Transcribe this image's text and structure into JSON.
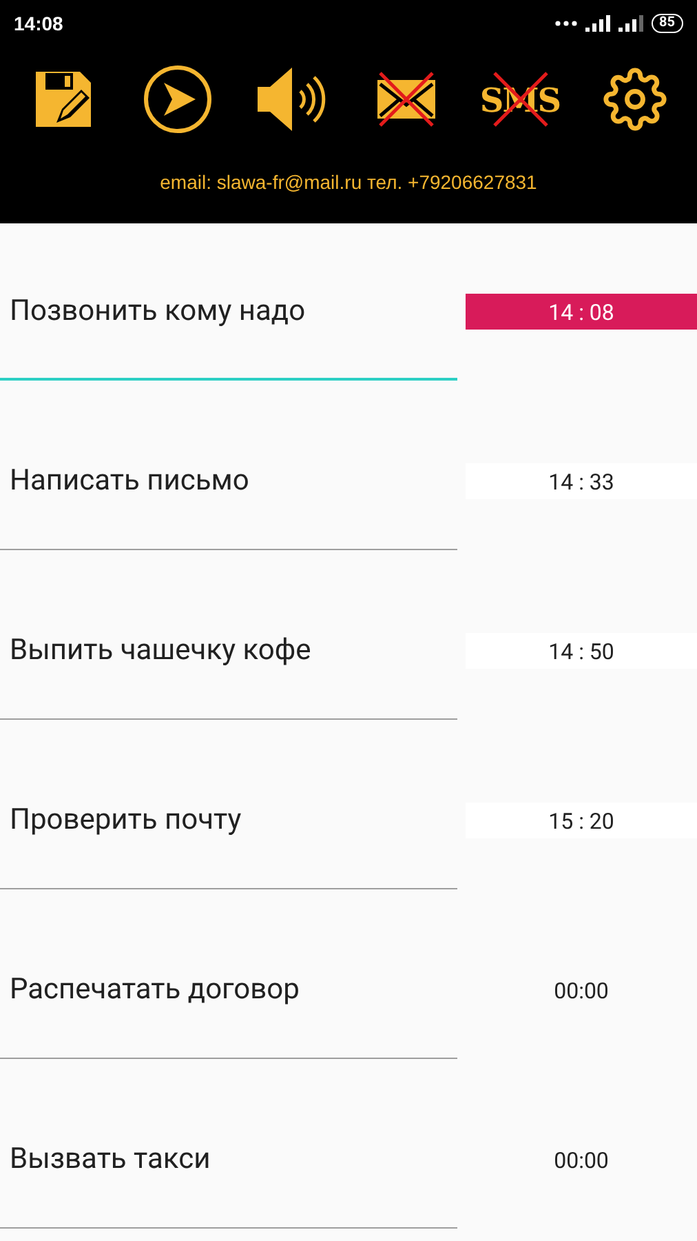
{
  "status_bar": {
    "time": "14:08",
    "battery": "85"
  },
  "toolbar": [
    {
      "kind": "save",
      "crossed": false
    },
    {
      "kind": "play",
      "crossed": false
    },
    {
      "kind": "sound",
      "crossed": false
    },
    {
      "kind": "mail",
      "crossed": true
    },
    {
      "kind": "sms",
      "label": "SMS",
      "crossed": true
    },
    {
      "kind": "settings",
      "crossed": false
    }
  ],
  "contact": "email: slawa-fr@mail.ru тел. +79206627831",
  "tasks": [
    {
      "title": "Позвонить кому надо",
      "time": "14 : 08",
      "kind": "set",
      "selected": true
    },
    {
      "title": "Написать письмо",
      "time": "14 : 33",
      "kind": "set",
      "selected": false
    },
    {
      "title": "Выпить чашечку кофе",
      "time": "14 : 50",
      "kind": "set",
      "selected": false
    },
    {
      "title": "Проверить почту",
      "time": "15 : 20",
      "kind": "set",
      "selected": false
    },
    {
      "title": "Распечатать договор",
      "time": "00:00",
      "kind": "unset",
      "selected": false
    },
    {
      "title": "Вызвать такси",
      "time": "00:00",
      "kind": "unset",
      "selected": false
    }
  ]
}
